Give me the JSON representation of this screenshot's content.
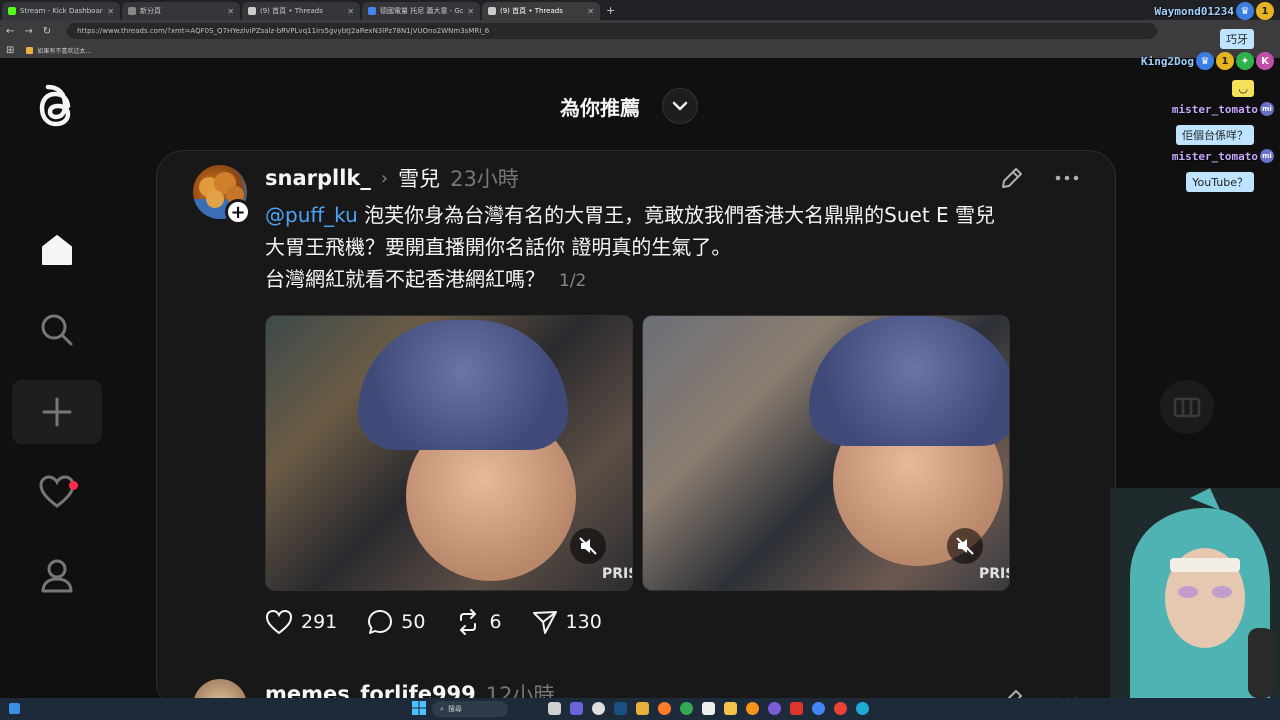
{
  "browser": {
    "tabs": [
      {
        "label": "Stream - Kick Dashboard",
        "color": "#53fc18"
      },
      {
        "label": "新分頁",
        "color": "#888888"
      },
      {
        "label": "(9) 首頁 • Threads",
        "color": "#cccccc"
      },
      {
        "label": "德國電量 托尼 蕭大童 - Google",
        "color": "#4285f4"
      },
      {
        "label": "(9) 首頁 • Threads",
        "color": "#cccccc"
      }
    ],
    "url": "https://www.threads.com/?xmt=AQF0S_Q7HYeziviPZsalz-bRVPLvq11irs5gvybtJ2aRexN3lPz78N1jVUOno2WNm3sMRI_6",
    "bookmark_label": "如果有不喜欢过太..."
  },
  "feed": {
    "title": "為你推薦"
  },
  "post": {
    "username": "snarpllk_",
    "topic": "雪兒",
    "time": "23小時",
    "mention": "@puff_ku",
    "text_line1_rest": " 泡芙你身為台灣有名的大胃王，竟敢放我們香港大名鼎鼎的Suet E 雪兒",
    "text_line2": "大胃王飛機？要開直播開你名話你 證明真的生氣了。",
    "text_line3": "台灣網紅就看不起香港網紅嗎？",
    "pager": "1/2",
    "watermark": "PRIS",
    "likes": "291",
    "replies": "50",
    "reposts": "6",
    "shares": "130"
  },
  "post2": {
    "username": "memes_forlife999",
    "time": "12小時"
  },
  "chat": {
    "user1": "Waymond01234",
    "msg1": "巧牙",
    "user2": "King2Dog",
    "user3": "mister_tomato",
    "msg3": "佢個台係咩？",
    "user4": "mister_tomato",
    "msg4": "YouTube？"
  },
  "taskbar": {
    "search_label": "搜尋"
  }
}
